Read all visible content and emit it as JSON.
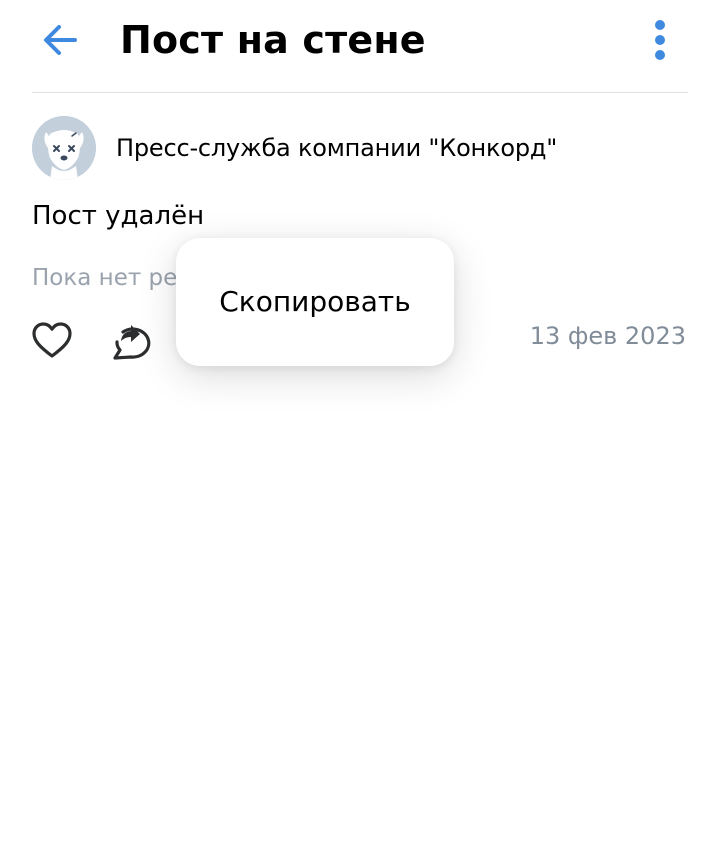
{
  "header": {
    "title": "Пост на стене",
    "back_icon": "arrow-left-icon",
    "more_icon": "more-vertical-icon"
  },
  "post": {
    "author": "Пресс-служба компании \"Конкорд\"",
    "avatar_icon": "deactivated-dog-avatar",
    "text": "Пост удалён",
    "comments_status": "Пока нет ре",
    "date": "13 фев 2023",
    "like_icon": "heart-icon",
    "share_icon": "share-icon"
  },
  "context_menu": {
    "items": [
      {
        "label": "Скопировать"
      }
    ]
  },
  "colors": {
    "accent": "#3f8ae0",
    "secondary_text": "#99a2ad",
    "date_text": "#818c99",
    "divider": "#dfe1e5",
    "avatar_bg": "#c4cfdc"
  }
}
